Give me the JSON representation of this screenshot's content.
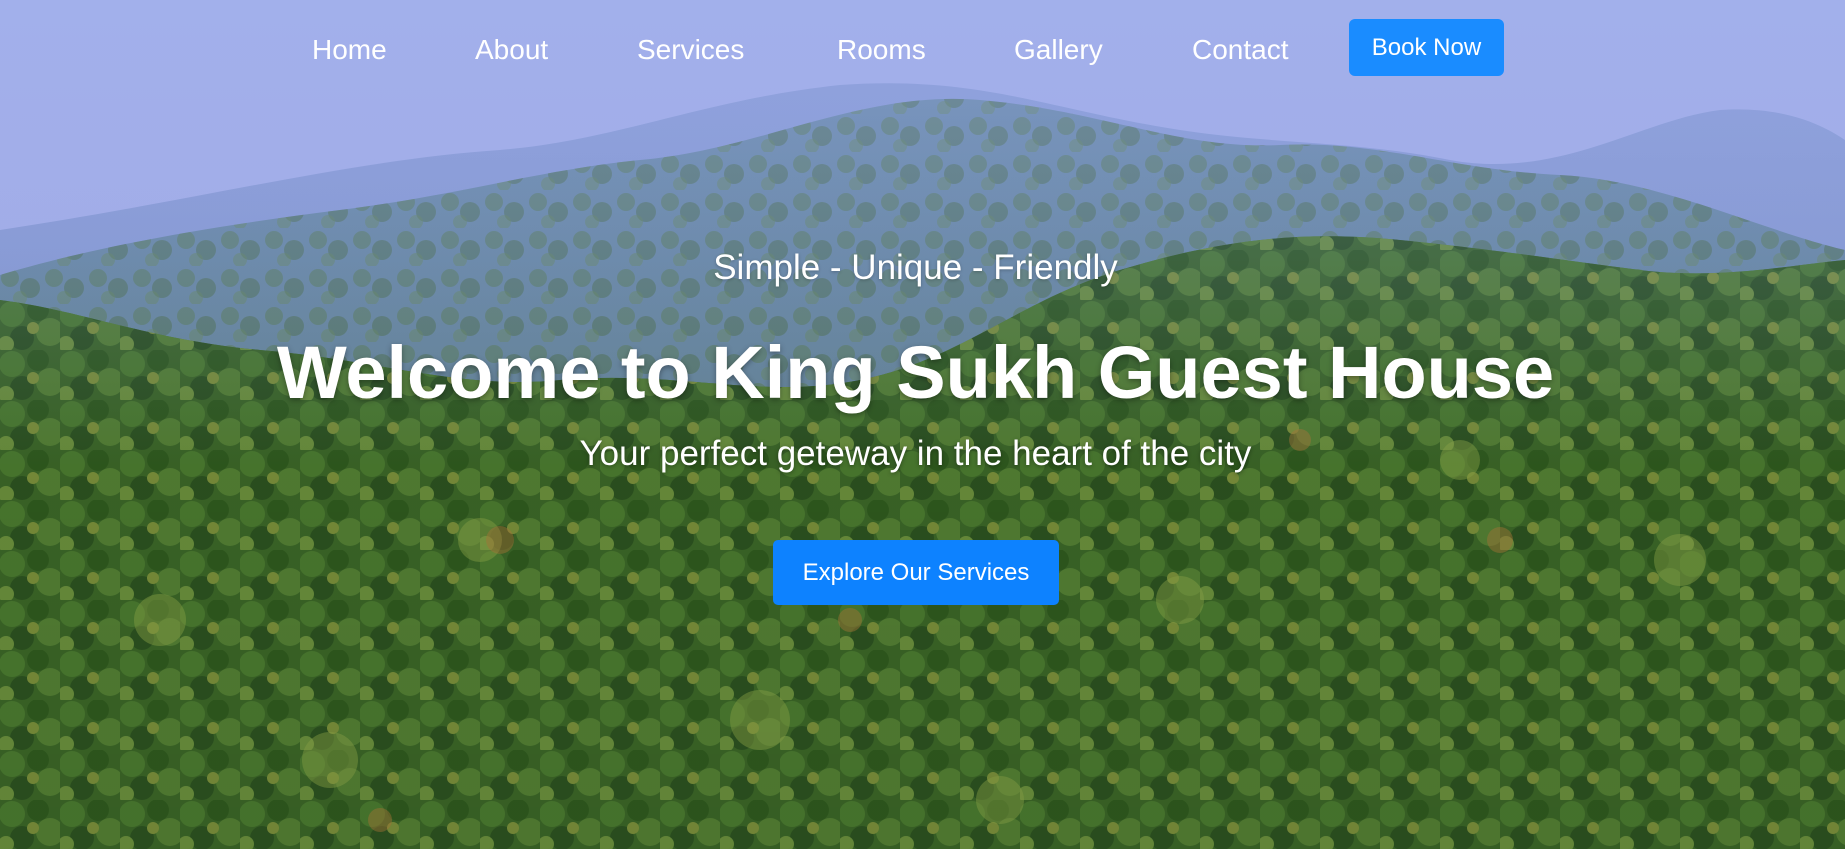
{
  "nav": {
    "items": [
      {
        "label": "Home"
      },
      {
        "label": "About"
      },
      {
        "label": "Services"
      },
      {
        "label": "Rooms"
      },
      {
        "label": "Gallery"
      },
      {
        "label": "Contact"
      }
    ],
    "book_now_label": "Book Now"
  },
  "hero": {
    "tagline": "Simple - Unique - Friendly",
    "title": "Welcome to King Sukh Guest House",
    "subtitle": "Your perfect geteway in the heart of the city",
    "cta_label": "Explore Our Services",
    "background_image": "forested-mountains-landscape"
  },
  "colors": {
    "accent": "#1a8cff",
    "text": "#ffffff"
  }
}
